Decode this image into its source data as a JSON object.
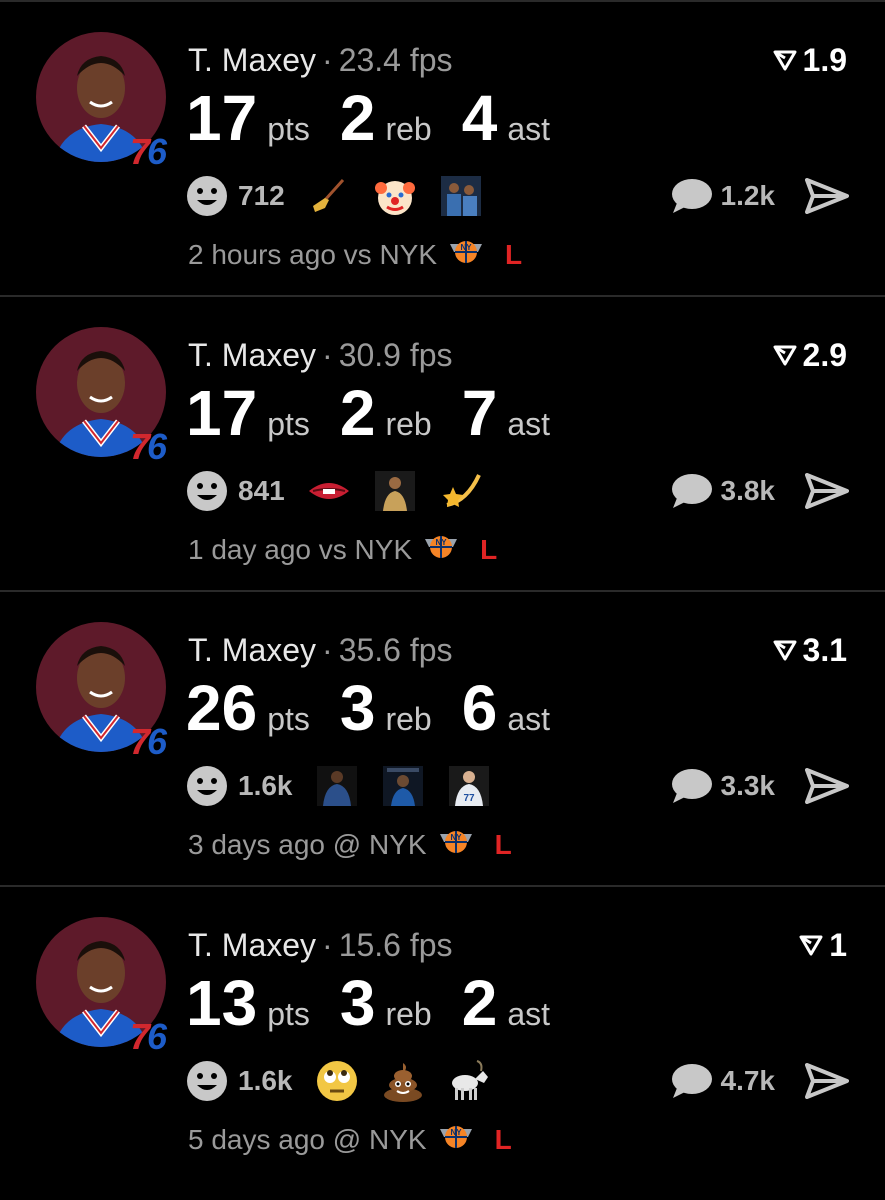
{
  "colors": {
    "background": "#000000",
    "avatar_bg": "#5e1a2a",
    "result_loss": "#e02424",
    "muted_text": "#9a9a9a"
  },
  "posts": [
    {
      "player": "T. Maxey",
      "fps": "23.4 fps",
      "rank": "1.9",
      "stats": [
        {
          "value": "17",
          "unit": "pts"
        },
        {
          "value": "2",
          "unit": "reb"
        },
        {
          "value": "4",
          "unit": "ast"
        }
      ],
      "reaction_count": "712",
      "reactions": [
        "broom-icon",
        "clown-face-icon",
        "players-photo-icon"
      ],
      "comment_count": "1.2k",
      "time": "2 hours ago",
      "opponent": "vs NYK",
      "result": "L"
    },
    {
      "player": "T. Maxey",
      "fps": "30.9 fps",
      "rank": "2.9",
      "stats": [
        {
          "value": "17",
          "unit": "pts"
        },
        {
          "value": "2",
          "unit": "reb"
        },
        {
          "value": "7",
          "unit": "ast"
        }
      ],
      "reaction_count": "841",
      "reactions": [
        "lip-bite-icon",
        "player-photo-icon",
        "shooting-star-icon"
      ],
      "comment_count": "3.8k",
      "time": "1 day ago",
      "opponent": "vs NYK",
      "result": "L"
    },
    {
      "player": "T. Maxey",
      "fps": "35.6 fps",
      "rank": "3.1",
      "stats": [
        {
          "value": "26",
          "unit": "pts"
        },
        {
          "value": "3",
          "unit": "reb"
        },
        {
          "value": "6",
          "unit": "ast"
        }
      ],
      "reaction_count": "1.6k",
      "reactions": [
        "player-photo-icon",
        "player-card-icon",
        "player-jersey-photo-icon"
      ],
      "comment_count": "3.3k",
      "time": "3 days ago",
      "opponent": "@ NYK",
      "result": "L"
    },
    {
      "player": "T. Maxey",
      "fps": "15.6 fps",
      "rank": "1",
      "stats": [
        {
          "value": "13",
          "unit": "pts"
        },
        {
          "value": "3",
          "unit": "reb"
        },
        {
          "value": "2",
          "unit": "ast"
        }
      ],
      "reaction_count": "1.6k",
      "reactions": [
        "eye-roll-face-icon",
        "poop-icon",
        "goat-icon"
      ],
      "comment_count": "4.7k",
      "time": "5 days ago",
      "opponent": "@ NYK",
      "result": "L"
    }
  ]
}
